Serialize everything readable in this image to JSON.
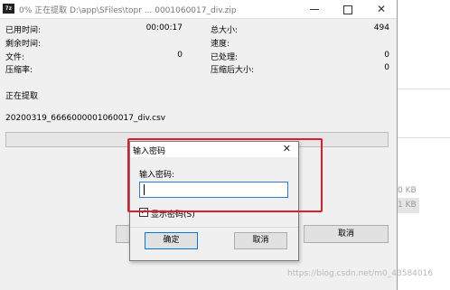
{
  "main_window": {
    "title": "0% 正在提取 D:\\app\\SFiles\\topr ... 0001060017_div.zip",
    "app_icon_text": "7z",
    "stats_left": [
      {
        "label": "已用时间:",
        "value": "00:00:17"
      },
      {
        "label": "剩余时间:",
        "value": ""
      },
      {
        "label": "文件:",
        "value": "0"
      },
      {
        "label": "压缩率:",
        "value": ""
      }
    ],
    "stats_right": [
      {
        "label": "总大小:",
        "value": "494"
      },
      {
        "label": "速度:",
        "value": ""
      },
      {
        "label": "已处理:",
        "value": "0"
      },
      {
        "label": "压缩后大小:",
        "value": "0"
      }
    ],
    "status_text": "正在提取",
    "current_file": "20200319_6666000001060017_div.csv",
    "progress_percent": 0,
    "cancel_label": "取消"
  },
  "background": {
    "size_1": "0 KB",
    "size_2": "1 KB"
  },
  "password_dialog": {
    "title": "输入密码",
    "prompt": "输入密码:",
    "password_value": "",
    "show_password_label": "显示密码(S)",
    "show_password_checked": true,
    "ok_label": "确定",
    "cancel_label": "取消"
  },
  "watermark": "https://blog.csdn.net/m0_43584016"
}
